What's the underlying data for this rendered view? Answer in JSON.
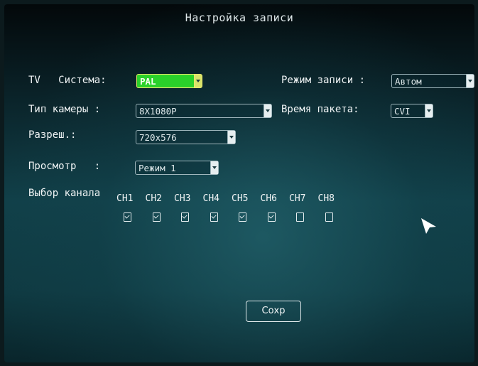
{
  "title": "Настройка записи",
  "tv_system": {
    "label": "TV   Система:",
    "value": "PAL"
  },
  "camera_type": {
    "label": "Тип камеры :",
    "value": "8X1080P"
  },
  "resolution": {
    "label": "Разреш.:",
    "value": "720x576"
  },
  "preview": {
    "label": "Просмотр   :",
    "value": "Режим 1"
  },
  "record_mode": {
    "label": "Режим записи :",
    "value": "Автом"
  },
  "packet_time": {
    "label": "Время пакета:",
    "value": "CVI"
  },
  "channel_select": {
    "label": "Выбор канала",
    "channels": [
      {
        "name": "CH1",
        "checked": true
      },
      {
        "name": "CH2",
        "checked": true
      },
      {
        "name": "CH3",
        "checked": true
      },
      {
        "name": "CH4",
        "checked": true
      },
      {
        "name": "CH5",
        "checked": true
      },
      {
        "name": "CH6",
        "checked": true
      },
      {
        "name": "CH7",
        "checked": false
      },
      {
        "name": "CH8",
        "checked": false
      }
    ]
  },
  "save_button": "Сохр",
  "colors": {
    "active_field": "#2ad12a",
    "background": "#114049"
  }
}
